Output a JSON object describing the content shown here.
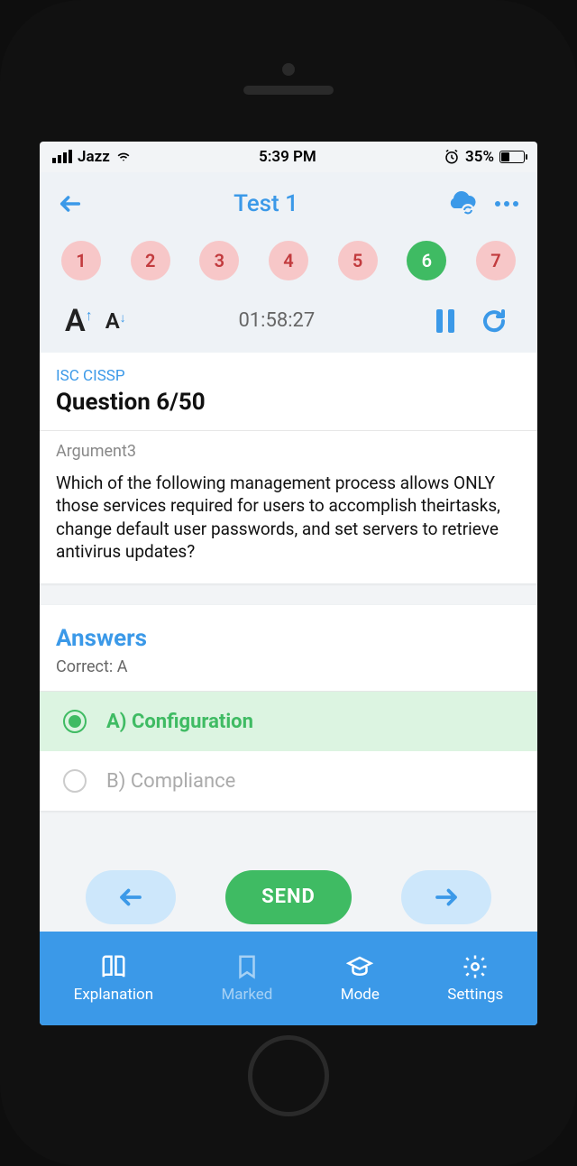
{
  "status": {
    "carrier": "Jazz",
    "time": "5:39 PM",
    "battery_pct": "35%"
  },
  "header": {
    "title": "Test 1"
  },
  "question_nav": {
    "items": [
      "1",
      "2",
      "3",
      "4",
      "5",
      "6",
      "7"
    ],
    "active_index": 5
  },
  "timer": "01:58:27",
  "card": {
    "exam": "ISC CISSP",
    "title": "Question 6/50",
    "argument": "Argument3",
    "text": "Which of the following management process allows ONLY those services required for users to accomplish theirtasks, change default user passwords, and set servers to retrieve antivirus updates?"
  },
  "answers": {
    "title": "Answers",
    "correct_label": "Correct: A",
    "items": [
      {
        "label": "A) Configuration",
        "selected": true
      },
      {
        "label": "B) Compliance",
        "selected": false
      }
    ]
  },
  "send_label": "SEND",
  "tabs": {
    "explanation": "Explanation",
    "marked": "Marked",
    "mode": "Mode",
    "settings": "Settings"
  }
}
